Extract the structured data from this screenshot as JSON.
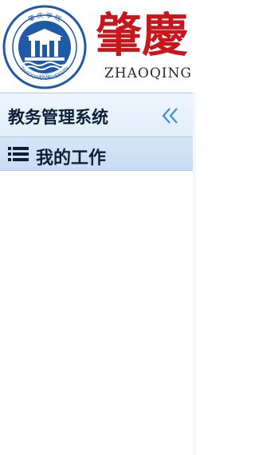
{
  "header": {
    "logo": {
      "seal_text_top": "肇 庆 学 院",
      "seal_text_bottom": "ZHAOQING UNIVERSITY",
      "seal_year": "1970",
      "brand_calligraphy": "肇慶",
      "brand_en": "ZHAOQING U"
    }
  },
  "sidebar": {
    "title": "教务管理系统",
    "collapse_icon": "double-chevron-left-icon",
    "sections": [
      {
        "label": "我的工作",
        "icon": "list-icon"
      }
    ]
  },
  "colors": {
    "header_bg": "#ffffff",
    "sidebar_header_bg": "#e7f0fb",
    "section_bg": "#d0e1f6",
    "border": "#a9c9ee",
    "accent_blue": "#2f6fb3",
    "brand_red": "#c8161d",
    "text_dark": "#0d1f36"
  }
}
